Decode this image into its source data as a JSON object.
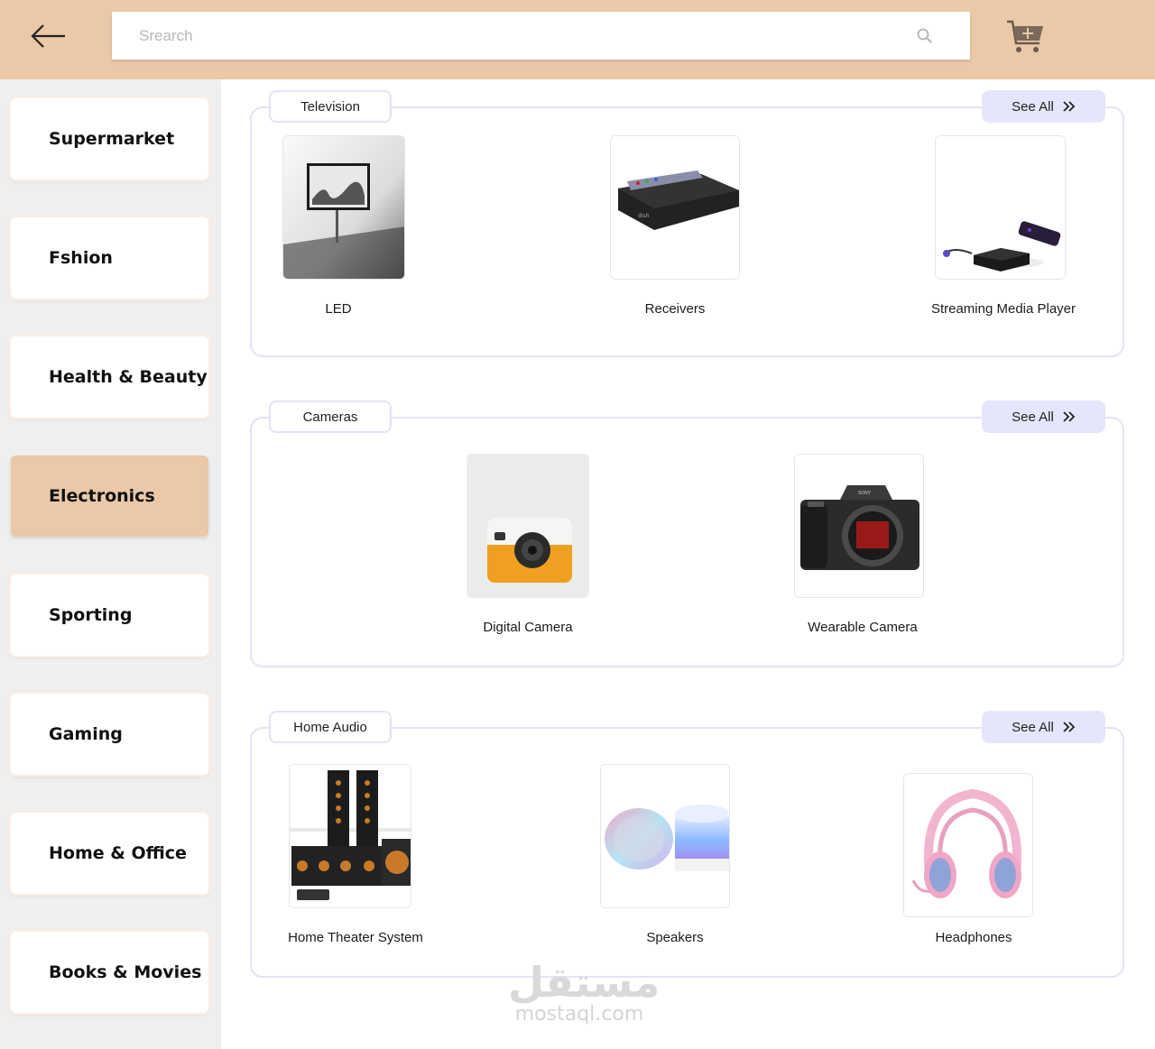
{
  "search": {
    "placeholder": "Srearch"
  },
  "sidebar": {
    "items": [
      {
        "label": "Supermarket"
      },
      {
        "label": "Fshion"
      },
      {
        "label": "Health & Beauty"
      },
      {
        "label": "Electronics",
        "active": true
      },
      {
        "label": "Sporting"
      },
      {
        "label": "Gaming"
      },
      {
        "label": "Home & Office"
      },
      {
        "label": "Books & Movies"
      }
    ]
  },
  "sections": [
    {
      "title": "Television",
      "see_all": "See All",
      "products": [
        {
          "label": "LED"
        },
        {
          "label": "Receivers"
        },
        {
          "label": "Streaming Media Player"
        }
      ]
    },
    {
      "title": "Cameras",
      "see_all": "See All",
      "products": [
        {
          "label": "Digital Camera"
        },
        {
          "label": "Wearable Camera"
        }
      ]
    },
    {
      "title": "Home Audio",
      "see_all": "See All",
      "products": [
        {
          "label": "Home Theater System"
        },
        {
          "label": "Speakers"
        },
        {
          "label": "Headphones"
        }
      ]
    }
  ],
  "watermark": {
    "arabic": "مستقل",
    "latin": "mostaql.com"
  },
  "colors": {
    "header_bg": "#eac8a8",
    "active_category": "#eac8a8",
    "see_all_bg": "#e5e5fb",
    "section_border": "#e3e3f7",
    "sidebar_bg": "#efefef"
  }
}
